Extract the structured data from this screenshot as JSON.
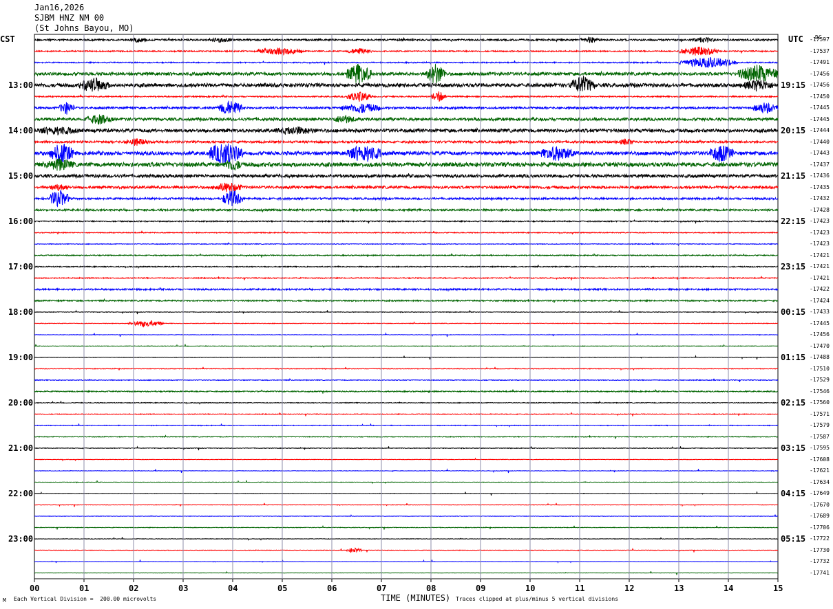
{
  "header": {
    "date": "Jan16,2026",
    "station": "SJBM HNZ NM 00",
    "location": "(St Johns Bayou, MO)"
  },
  "left_tz": "CST",
  "right_tz": "UTC",
  "dc_label": "DC",
  "footer": {
    "scale": "Each Vertical Division =  200.00 microvolts",
    "clip": "Traces clipped at plus/minus 5 vertical divisions",
    "mark": "M"
  },
  "colors": {
    "cycle": [
      "#000000",
      "#ff0000",
      "#0000ff",
      "#006400"
    ],
    "grid": "#8c8ca8"
  },
  "chart_data": {
    "type": "line",
    "title": "",
    "xlabel": "TIME (MINUTES)",
    "ylabel": "",
    "xlim": [
      0,
      15
    ],
    "x_ticks": [
      "00",
      "01",
      "02",
      "03",
      "04",
      "05",
      "06",
      "07",
      "08",
      "09",
      "10",
      "11",
      "12",
      "13",
      "14",
      "15"
    ],
    "left_hour_labels": [
      "13:00",
      "14:00",
      "15:00",
      "16:00",
      "17:00",
      "18:00",
      "19:00",
      "20:00",
      "21:00",
      "22:00",
      "23:00"
    ],
    "right_hour_labels": [
      "19:15",
      "20:15",
      "21:15",
      "22:15",
      "23:15",
      "00:15",
      "01:15",
      "02:15",
      "03:15",
      "04:15",
      "05:15"
    ],
    "trace_offsets": [
      -17597,
      -17537,
      -17491,
      -17456,
      -17456,
      -17450,
      -17445,
      -17445,
      -17444,
      -17440,
      -17443,
      -17437,
      -17436,
      -17435,
      -17432,
      -17428,
      -17423,
      -17423,
      -17423,
      -17421,
      -17421,
      -17421,
      -17422,
      -17424,
      -17433,
      -17445,
      -17456,
      -17470,
      -17488,
      -17510,
      -17529,
      -17546,
      -17560,
      -17571,
      -17579,
      -17587,
      -17595,
      -17608,
      -17621,
      -17634,
      -17649,
      -17670,
      -17689,
      -17706,
      -17722,
      -17730,
      -17732,
      -17741
    ],
    "trace_noise": [
      1.2,
      0.9,
      0.8,
      2.2,
      2.6,
      0.9,
      1.5,
      2.0,
      2.4,
      1.6,
      2.6,
      3.0,
      2.2,
      1.9,
      1.4,
      1.3,
      0.8,
      0.6,
      0.5,
      0.7,
      0.7,
      0.7,
      1.1,
      0.9,
      0.4,
      0.4,
      0.3,
      0.4,
      0.3,
      0.4,
      0.5,
      0.8,
      0.5,
      0.5,
      0.5,
      0.5,
      0.4,
      0.3,
      0.3,
      0.3,
      0.3,
      0.3,
      0.3,
      0.4,
      0.3,
      0.3,
      0.2,
      0.2
    ],
    "events": [
      {
        "trace": 0,
        "start": 1.9,
        "end": 2.3,
        "amp": 4
      },
      {
        "trace": 0,
        "start": 3.5,
        "end": 4.0,
        "amp": 4
      },
      {
        "trace": 0,
        "start": 11.0,
        "end": 11.4,
        "amp": 5
      },
      {
        "trace": 0,
        "start": 13.2,
        "end": 13.8,
        "amp": 4
      },
      {
        "trace": 1,
        "start": 4.5,
        "end": 5.4,
        "amp": 6
      },
      {
        "trace": 1,
        "start": 6.3,
        "end": 6.8,
        "amp": 5
      },
      {
        "trace": 1,
        "start": 13.0,
        "end": 13.8,
        "amp": 7
      },
      {
        "trace": 2,
        "start": 13.0,
        "end": 14.2,
        "amp": 8
      },
      {
        "trace": 3,
        "start": 6.3,
        "end": 6.8,
        "amp": 16
      },
      {
        "trace": 3,
        "start": 7.9,
        "end": 8.3,
        "amp": 16
      },
      {
        "trace": 3,
        "start": 14.2,
        "end": 15.0,
        "amp": 14
      },
      {
        "trace": 4,
        "start": 0.9,
        "end": 1.5,
        "amp": 12
      },
      {
        "trace": 4,
        "start": 10.8,
        "end": 11.3,
        "amp": 14
      },
      {
        "trace": 4,
        "start": 14.3,
        "end": 14.9,
        "amp": 10
      },
      {
        "trace": 5,
        "start": 6.3,
        "end": 6.8,
        "amp": 8
      },
      {
        "trace": 5,
        "start": 8.0,
        "end": 8.3,
        "amp": 8
      },
      {
        "trace": 6,
        "start": 0.5,
        "end": 0.8,
        "amp": 10
      },
      {
        "trace": 6,
        "start": 3.7,
        "end": 4.2,
        "amp": 12
      },
      {
        "trace": 6,
        "start": 6.2,
        "end": 7.0,
        "amp": 8
      },
      {
        "trace": 6,
        "start": 14.5,
        "end": 15.0,
        "amp": 9
      },
      {
        "trace": 7,
        "start": 1.0,
        "end": 1.6,
        "amp": 8
      },
      {
        "trace": 7,
        "start": 6.0,
        "end": 6.5,
        "amp": 7
      },
      {
        "trace": 8,
        "start": 0.0,
        "end": 0.9,
        "amp": 7
      },
      {
        "trace": 8,
        "start": 4.8,
        "end": 5.7,
        "amp": 7
      },
      {
        "trace": 9,
        "start": 1.8,
        "end": 2.3,
        "amp": 6
      },
      {
        "trace": 9,
        "start": 11.8,
        "end": 12.1,
        "amp": 6
      },
      {
        "trace": 10,
        "start": 0.3,
        "end": 0.8,
        "amp": 16
      },
      {
        "trace": 10,
        "start": 3.5,
        "end": 4.2,
        "amp": 18
      },
      {
        "trace": 10,
        "start": 6.3,
        "end": 7.0,
        "amp": 14
      },
      {
        "trace": 10,
        "start": 10.2,
        "end": 10.9,
        "amp": 12
      },
      {
        "trace": 10,
        "start": 13.6,
        "end": 14.1,
        "amp": 14
      },
      {
        "trace": 11,
        "start": 0.2,
        "end": 0.8,
        "amp": 10
      },
      {
        "trace": 11,
        "start": 3.8,
        "end": 4.2,
        "amp": 10
      },
      {
        "trace": 13,
        "start": 0.3,
        "end": 0.7,
        "amp": 6
      },
      {
        "trace": 13,
        "start": 3.6,
        "end": 4.2,
        "amp": 8
      },
      {
        "trace": 14,
        "start": 0.3,
        "end": 0.7,
        "amp": 14
      },
      {
        "trace": 14,
        "start": 3.8,
        "end": 4.2,
        "amp": 14
      },
      {
        "trace": 25,
        "start": 1.9,
        "end": 2.6,
        "amp": 5
      },
      {
        "trace": 45,
        "start": 6.3,
        "end": 6.6,
        "amp": 4
      }
    ]
  }
}
